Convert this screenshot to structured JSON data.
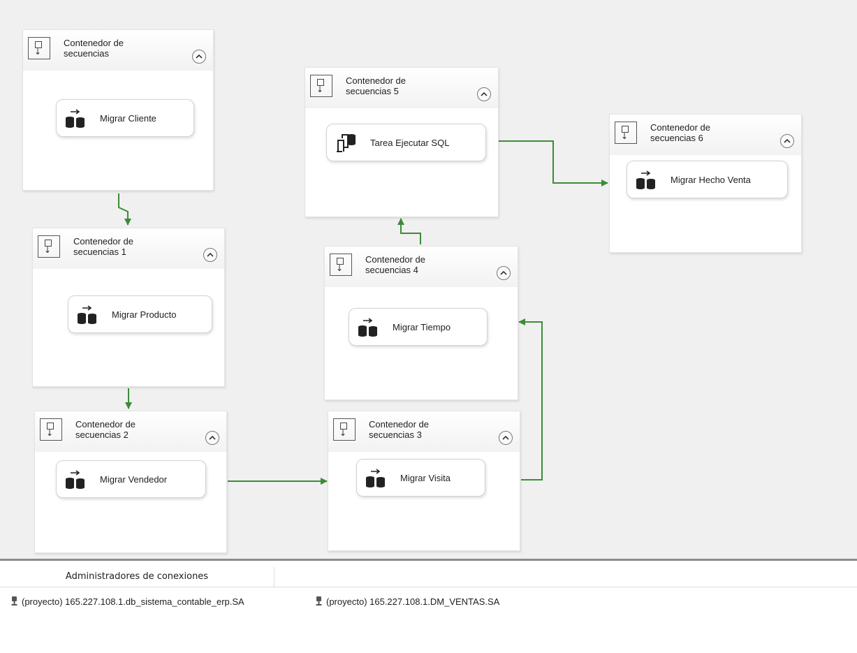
{
  "containers": [
    {
      "title": "Contenedor de secuencias",
      "task": {
        "label": "Migrar Cliente",
        "icon": "data-flow-icon"
      }
    },
    {
      "title": "Contenedor de secuencias 1",
      "task": {
        "label": "Migrar Producto",
        "icon": "data-flow-icon"
      }
    },
    {
      "title": "Contenedor de secuencias 2",
      "task": {
        "label": "Migrar Vendedor",
        "icon": "data-flow-icon"
      }
    },
    {
      "title": "Contenedor de secuencias 3",
      "task": {
        "label": "Migrar Visita",
        "icon": "data-flow-icon"
      }
    },
    {
      "title": "Contenedor de secuencias 4",
      "task": {
        "label": "Migrar Tiempo",
        "icon": "data-flow-icon"
      }
    },
    {
      "title": "Contenedor de secuencias 5",
      "task": {
        "label": "Tarea Ejecutar SQL",
        "icon": "execute-sql-icon"
      }
    },
    {
      "title": "Contenedor de secuencias 6",
      "task": {
        "label": "Migrar Hecho Venta",
        "icon": "data-flow-icon"
      }
    }
  ],
  "precedence_color": "#3d8b37",
  "connection_managers": {
    "tab_label": "Administradores de conexiones",
    "items": [
      {
        "label": "(proyecto) 165.227.108.1.db_sistema_contable_erp.SA",
        "icon": "connection-icon"
      },
      {
        "label": "(proyecto) 165.227.108.1.DM_VENTAS.SA",
        "icon": "connection-icon"
      }
    ]
  }
}
